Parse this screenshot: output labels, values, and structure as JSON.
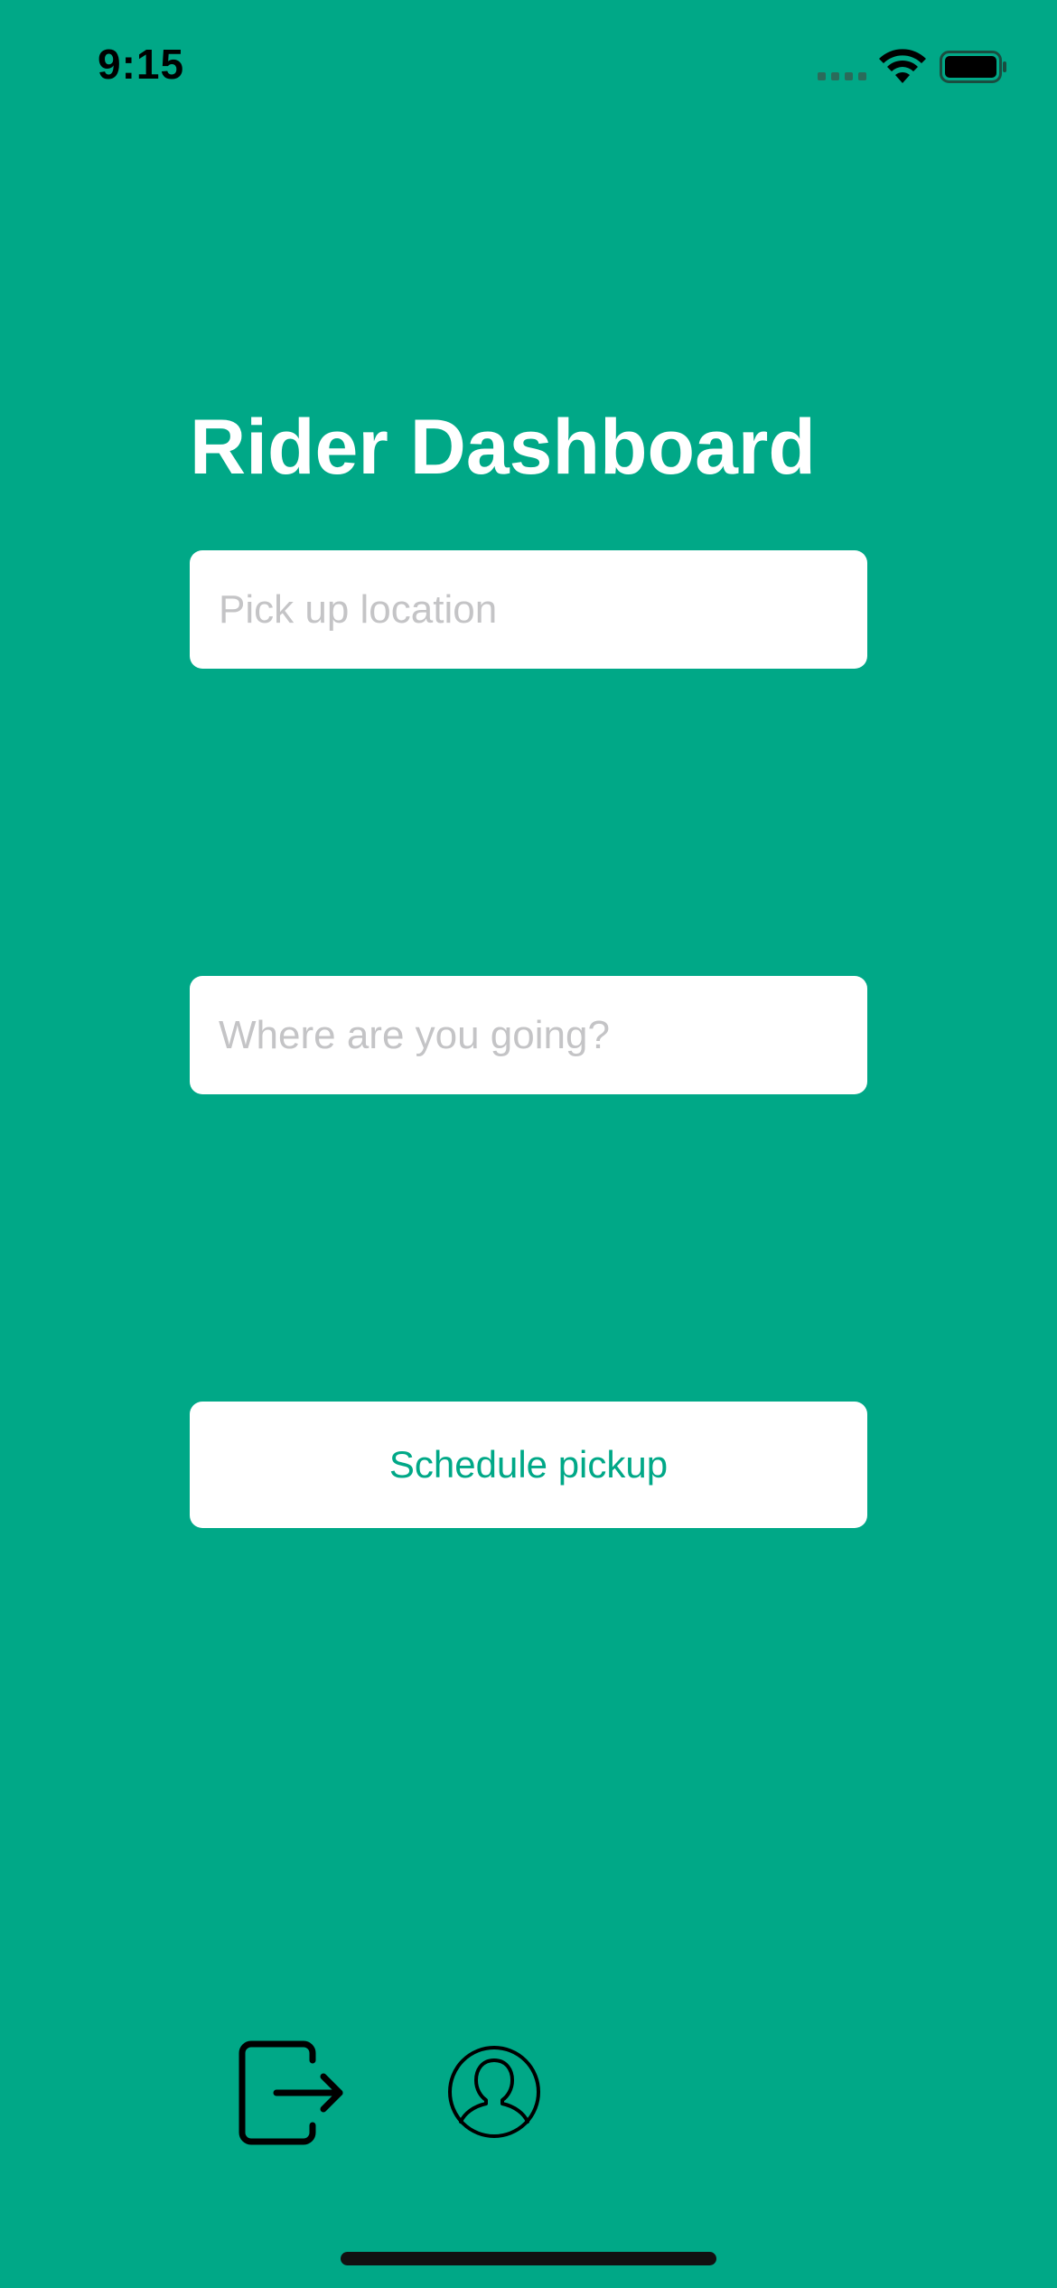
{
  "status_bar": {
    "time": "9:15"
  },
  "header": {
    "title": "Rider Dashboard"
  },
  "form": {
    "pickup": {
      "placeholder": "Pick up location",
      "value": ""
    },
    "destination": {
      "placeholder": "Where are you going?",
      "value": ""
    },
    "schedule_label": "Schedule pickup"
  },
  "toolbar": {
    "logout_icon": "logout-icon",
    "profile_icon": "profile-icon"
  },
  "colors": {
    "background": "#00A887",
    "accent": "#00A887",
    "field_background": "#FFFFFF",
    "placeholder": "#C4C4C6"
  }
}
